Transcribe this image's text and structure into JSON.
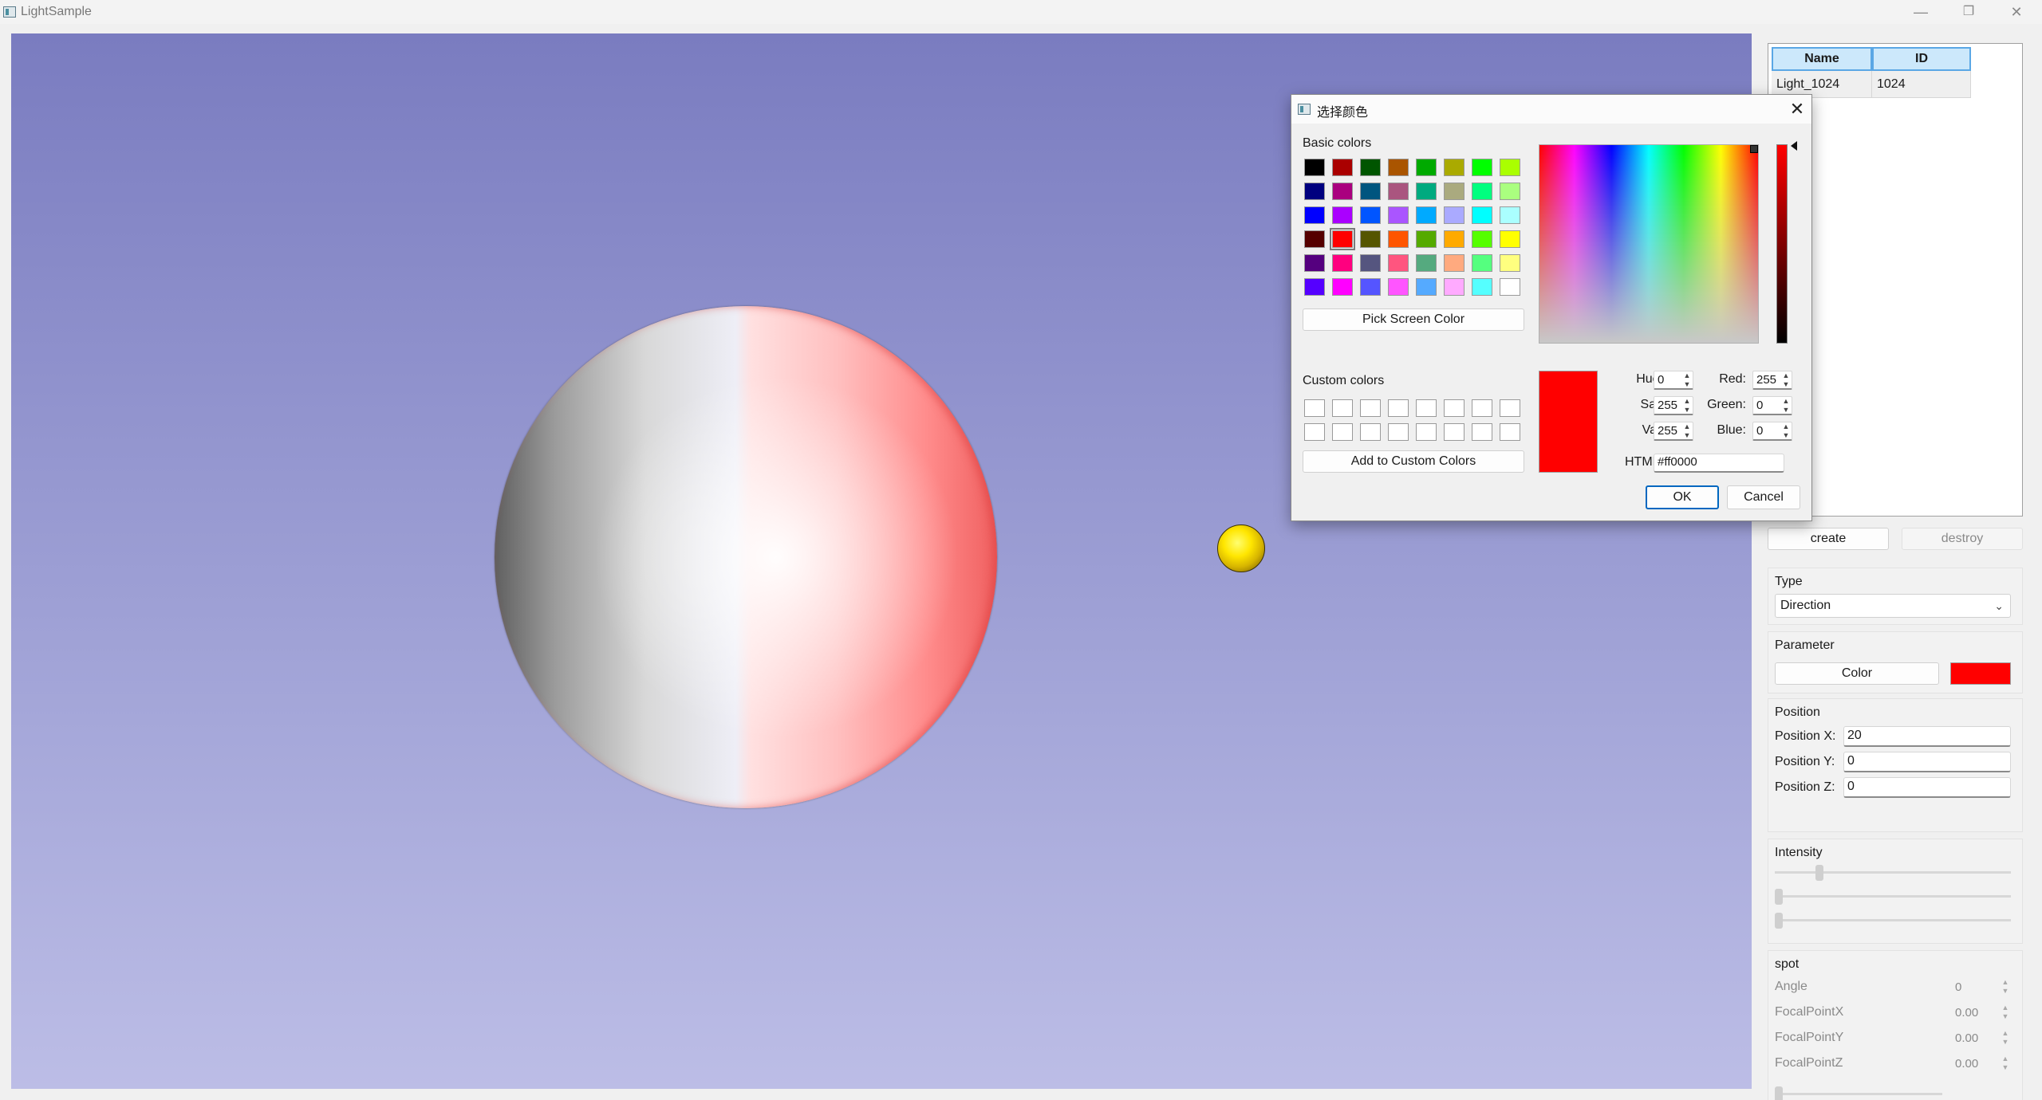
{
  "window": {
    "title": "LightSample",
    "minimize": "—",
    "maximize": "❐",
    "close": "✕"
  },
  "table": {
    "headers": [
      "Name",
      "ID"
    ],
    "rows": [
      {
        "name": "Light_1024",
        "id": "1024"
      }
    ]
  },
  "buttons": {
    "create": "create",
    "destroy": "destroy"
  },
  "type_group": {
    "title": "Type",
    "selected": "Direction"
  },
  "parameter_group": {
    "title": "Parameter",
    "color_button": "Color",
    "color_value": "#ff0000"
  },
  "position_group": {
    "title": "Position",
    "x_label": "Position X:",
    "x_value": "20",
    "y_label": "Position Y:",
    "y_value": "0",
    "z_label": "Position Z:",
    "z_value": "0"
  },
  "intensity_group": {
    "title": "Intensity",
    "slider1_level": 0.18,
    "slider2_level": 0.0,
    "slider3_level": 0.0
  },
  "spot_group": {
    "title": "spot",
    "angle_label": "Angle",
    "angle_value": "0",
    "fx_label": "FocalPointX",
    "fx_value": "0.00",
    "fy_label": "FocalPointY",
    "fy_value": "0.00",
    "fz_label": "FocalPointZ",
    "fz_value": "0.00"
  },
  "dialog": {
    "title": "选择颜色",
    "close": "✕",
    "basic_colors_label": "Basic colors",
    "basic_colors": [
      [
        "#000000",
        "#aa0000",
        "#005500",
        "#aa5500",
        "#00aa00",
        "#aaaa00",
        "#00ff00",
        "#aaff00"
      ],
      [
        "#00007f",
        "#aa007f",
        "#00557f",
        "#aa557f",
        "#00aa7f",
        "#aaaa7f",
        "#00ff7f",
        "#aaff7f"
      ],
      [
        "#0000ff",
        "#aa00ff",
        "#0055ff",
        "#aa55ff",
        "#00aaff",
        "#aaaaff",
        "#00ffff",
        "#aaffff"
      ],
      [
        "#550000",
        "#ff0000",
        "#555500",
        "#ff5500",
        "#55aa00",
        "#ffaa00",
        "#55ff00",
        "#ffff00"
      ],
      [
        "#55007f",
        "#ff007f",
        "#55557f",
        "#ff557f",
        "#55aa7f",
        "#ffaa7f",
        "#55ff7f",
        "#ffff7f"
      ],
      [
        "#5500ff",
        "#ff00ff",
        "#5555ff",
        "#ff55ff",
        "#55aaff",
        "#ffaaff",
        "#55ffff",
        "#ffffff"
      ]
    ],
    "selected_basic": [
      3,
      1
    ],
    "pick_screen_color": "Pick Screen Color",
    "custom_colors_label": "Custom colors",
    "add_custom_colors": "Add to Custom Colors",
    "hue_label": "Hue:",
    "hue": "0",
    "sat_label": "Sat:",
    "sat": "255",
    "val_label": "Val:",
    "val": "255",
    "red_label": "Red:",
    "red": "255",
    "green_label": "Green:",
    "green": "0",
    "blue_label": "Blue:",
    "blue": "0",
    "html_label": "HTML:",
    "html": "#ff0000",
    "current_color": "#ff0000",
    "ok": "OK",
    "cancel": "Cancel"
  }
}
